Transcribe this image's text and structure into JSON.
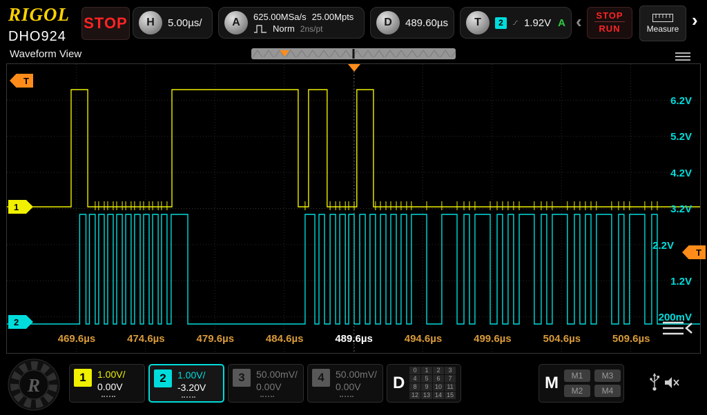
{
  "colors": {
    "ch1": "#f0f000",
    "ch2": "#00dcdc",
    "trigger": "#ff8c1a",
    "stop_red": "#ff2424",
    "green": "#2ecc40",
    "time_label": "#d89a3a"
  },
  "icons": {
    "toolbar_scroll_left": "‹",
    "toolbar_scroll_right": "›"
  },
  "topbar": {
    "logo": "RIGOL",
    "status": "STOP",
    "h": {
      "label": "H",
      "value": "5.00µs/"
    },
    "a": {
      "label": "A",
      "rate": "625.00MSa/s",
      "depth": "25.00Mpts",
      "mode": "Norm",
      "per_pt": "2ns/pt"
    },
    "d": {
      "label": "D",
      "value": "489.60µs"
    },
    "t": {
      "label": "T",
      "source": "2",
      "level": "1.92V",
      "mode_flag": "A"
    },
    "stop_run": {
      "line1": "STOP",
      "line2": "RUN"
    },
    "measure": "Measure"
  },
  "header": {
    "model": "DHO924",
    "view_title": "Waveform View"
  },
  "scope": {
    "voltage_labels": [
      "6.2V",
      "5.2V",
      "4.2V",
      "3.2V",
      "2.2V",
      "1.2V",
      "200mV"
    ],
    "time_labels": [
      "469.6µs",
      "474.6µs",
      "479.6µs",
      "484.6µs",
      "489.6µs",
      "494.6µs",
      "499.6µs",
      "504.6µs",
      "509.6µs"
    ],
    "trigger_time_label": "489.6µs",
    "markers": {
      "ch1": "1",
      "ch2": "2",
      "trigger": "T"
    }
  },
  "bottom": {
    "channels": [
      {
        "num": "1",
        "scale": "1.00V/",
        "offset": "0.00V",
        "enabled": true,
        "selected": false
      },
      {
        "num": "2",
        "scale": "1.00V/",
        "offset": "-3.20V",
        "enabled": true,
        "selected": true
      },
      {
        "num": "3",
        "scale": "50.00mV/",
        "offset": "0.00V",
        "enabled": false,
        "selected": false
      },
      {
        "num": "4",
        "scale": "50.00mV/",
        "offset": "0.00V",
        "enabled": false,
        "selected": false
      }
    ],
    "digital": {
      "label": "D",
      "rows": [
        [
          "0",
          "1",
          "2",
          "3"
        ],
        [
          "4",
          "5",
          "6",
          "7"
        ],
        [
          "8",
          "9",
          "10",
          "11"
        ],
        [
          "12",
          "13",
          "14",
          "15"
        ]
      ]
    },
    "math": {
      "label": "M",
      "buttons": [
        "M1",
        "M3",
        "M2",
        "M4"
      ]
    }
  },
  "chart_data": {
    "type": "line",
    "title": "Waveform View",
    "x_unit": "µs",
    "x_range_us": [
      464.6,
      514.6
    ],
    "timebase": "5.00µs/div",
    "grid": "dotted 10x8 divisions",
    "trigger": {
      "source_channel": 2,
      "level_v": 1.92,
      "slope": "rising",
      "position_us": 489.6
    },
    "series": [
      {
        "name": "CH1",
        "color": "#f0f000",
        "volts_per_div": 1.0,
        "low_v": 0.0,
        "high_v": 3.3,
        "pulses_us": [
          [
            469.23,
            470.43
          ],
          [
            476.5,
            485.61
          ],
          [
            486.36,
            487.7
          ],
          [
            489.84,
            491.04
          ]
        ]
      },
      {
        "name": "CH2",
        "color": "#00dcdc",
        "volts_per_div": 1.0,
        "low_v": 0.0,
        "high_v": 3.05,
        "pulses_us": [
          [
            469.85,
            470.3
          ],
          [
            470.55,
            470.97
          ],
          [
            471.22,
            471.62
          ],
          [
            471.87,
            472.27
          ],
          [
            472.52,
            472.92
          ],
          [
            473.17,
            473.56
          ],
          [
            473.81,
            474.21
          ],
          [
            474.46,
            474.86
          ],
          [
            475.11,
            475.51
          ],
          [
            475.75,
            476.15
          ],
          [
            476.45,
            477.65
          ],
          [
            486.11,
            486.81
          ],
          [
            487.11,
            487.51
          ],
          [
            487.91,
            488.31
          ],
          [
            488.61,
            489.01
          ],
          [
            489.25,
            489.65
          ],
          [
            490.05,
            490.45
          ],
          [
            490.79,
            491.19
          ],
          [
            491.54,
            491.94
          ],
          [
            492.29,
            492.69
          ],
          [
            493.03,
            493.43
          ],
          [
            493.78,
            494.88
          ],
          [
            495.97,
            497.07
          ],
          [
            497.57,
            497.96
          ],
          [
            498.36,
            499.46
          ],
          [
            499.96,
            500.35
          ],
          [
            500.75,
            501.15
          ],
          [
            501.55,
            502.64
          ],
          [
            503.14,
            503.54
          ],
          [
            503.94,
            505.03
          ],
          [
            505.53,
            505.93
          ],
          [
            506.33,
            506.73
          ],
          [
            507.12,
            508.22
          ],
          [
            508.72,
            509.11
          ],
          [
            509.51,
            510.61
          ],
          [
            511.11,
            511.51
          ]
        ]
      }
    ]
  }
}
